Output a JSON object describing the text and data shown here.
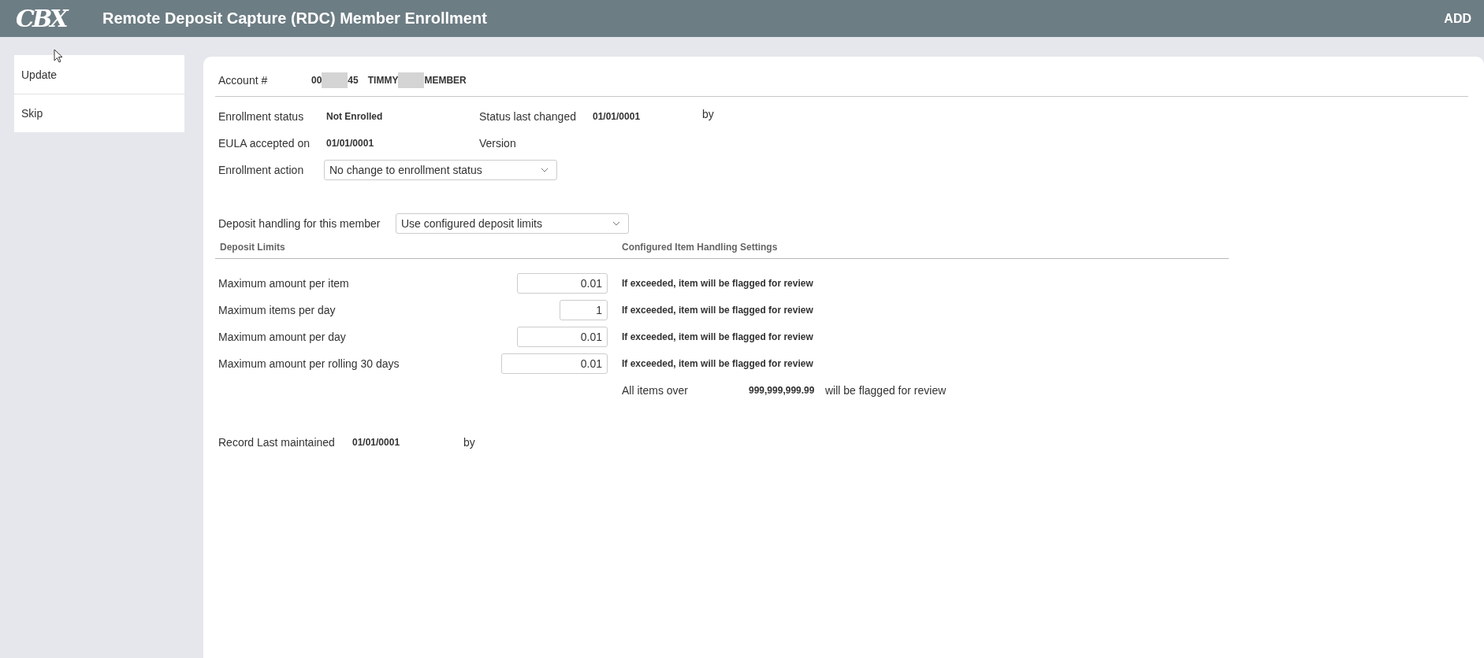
{
  "header": {
    "logo": "CBX",
    "title": "Remote Deposit Capture (RDC) Member Enrollment",
    "action": "ADD"
  },
  "sidebar": {
    "items": [
      "Update",
      "Skip"
    ]
  },
  "account": {
    "label": "Account #",
    "number_start": "00",
    "number_end": "45",
    "name_first": "TIMMY",
    "name_last": "MEMBER"
  },
  "enrollment": {
    "status_label": "Enrollment status",
    "status": "Not Enrolled",
    "changed_label": "Status last changed",
    "changed": "01/01/0001",
    "changed_by_label": "by",
    "eula_label": "EULA accepted on",
    "eula": "01/01/0001",
    "version_label": "Version",
    "action_label": "Enrollment action",
    "action": "No change to enrollment status"
  },
  "deposit_handling": {
    "label": "Deposit handling for this member",
    "value": "Use configured deposit limits"
  },
  "limits": {
    "heading": "Deposit Limits",
    "settings_heading": "Configured Item Handling Settings",
    "rows": [
      {
        "label": "Maximum amount per item",
        "value": "0.01",
        "handling": "If exceeded, item will be flagged for review"
      },
      {
        "label": "Maximum items per day",
        "value": "1",
        "handling": "If exceeded, item will be flagged for review"
      },
      {
        "label": "Maximum amount per day",
        "value": "0.01",
        "handling": "If exceeded, item will be flagged for review"
      },
      {
        "label": "Maximum amount per rolling 30 days",
        "value": "0.01",
        "handling": "If exceeded, item will be flagged for review"
      }
    ],
    "over_label": "All items over",
    "over_value": "999,999,999.99",
    "over_note": "will be flagged for review"
  },
  "record": {
    "label": "Record Last maintained",
    "date": "01/01/0001",
    "by_label": "by"
  }
}
